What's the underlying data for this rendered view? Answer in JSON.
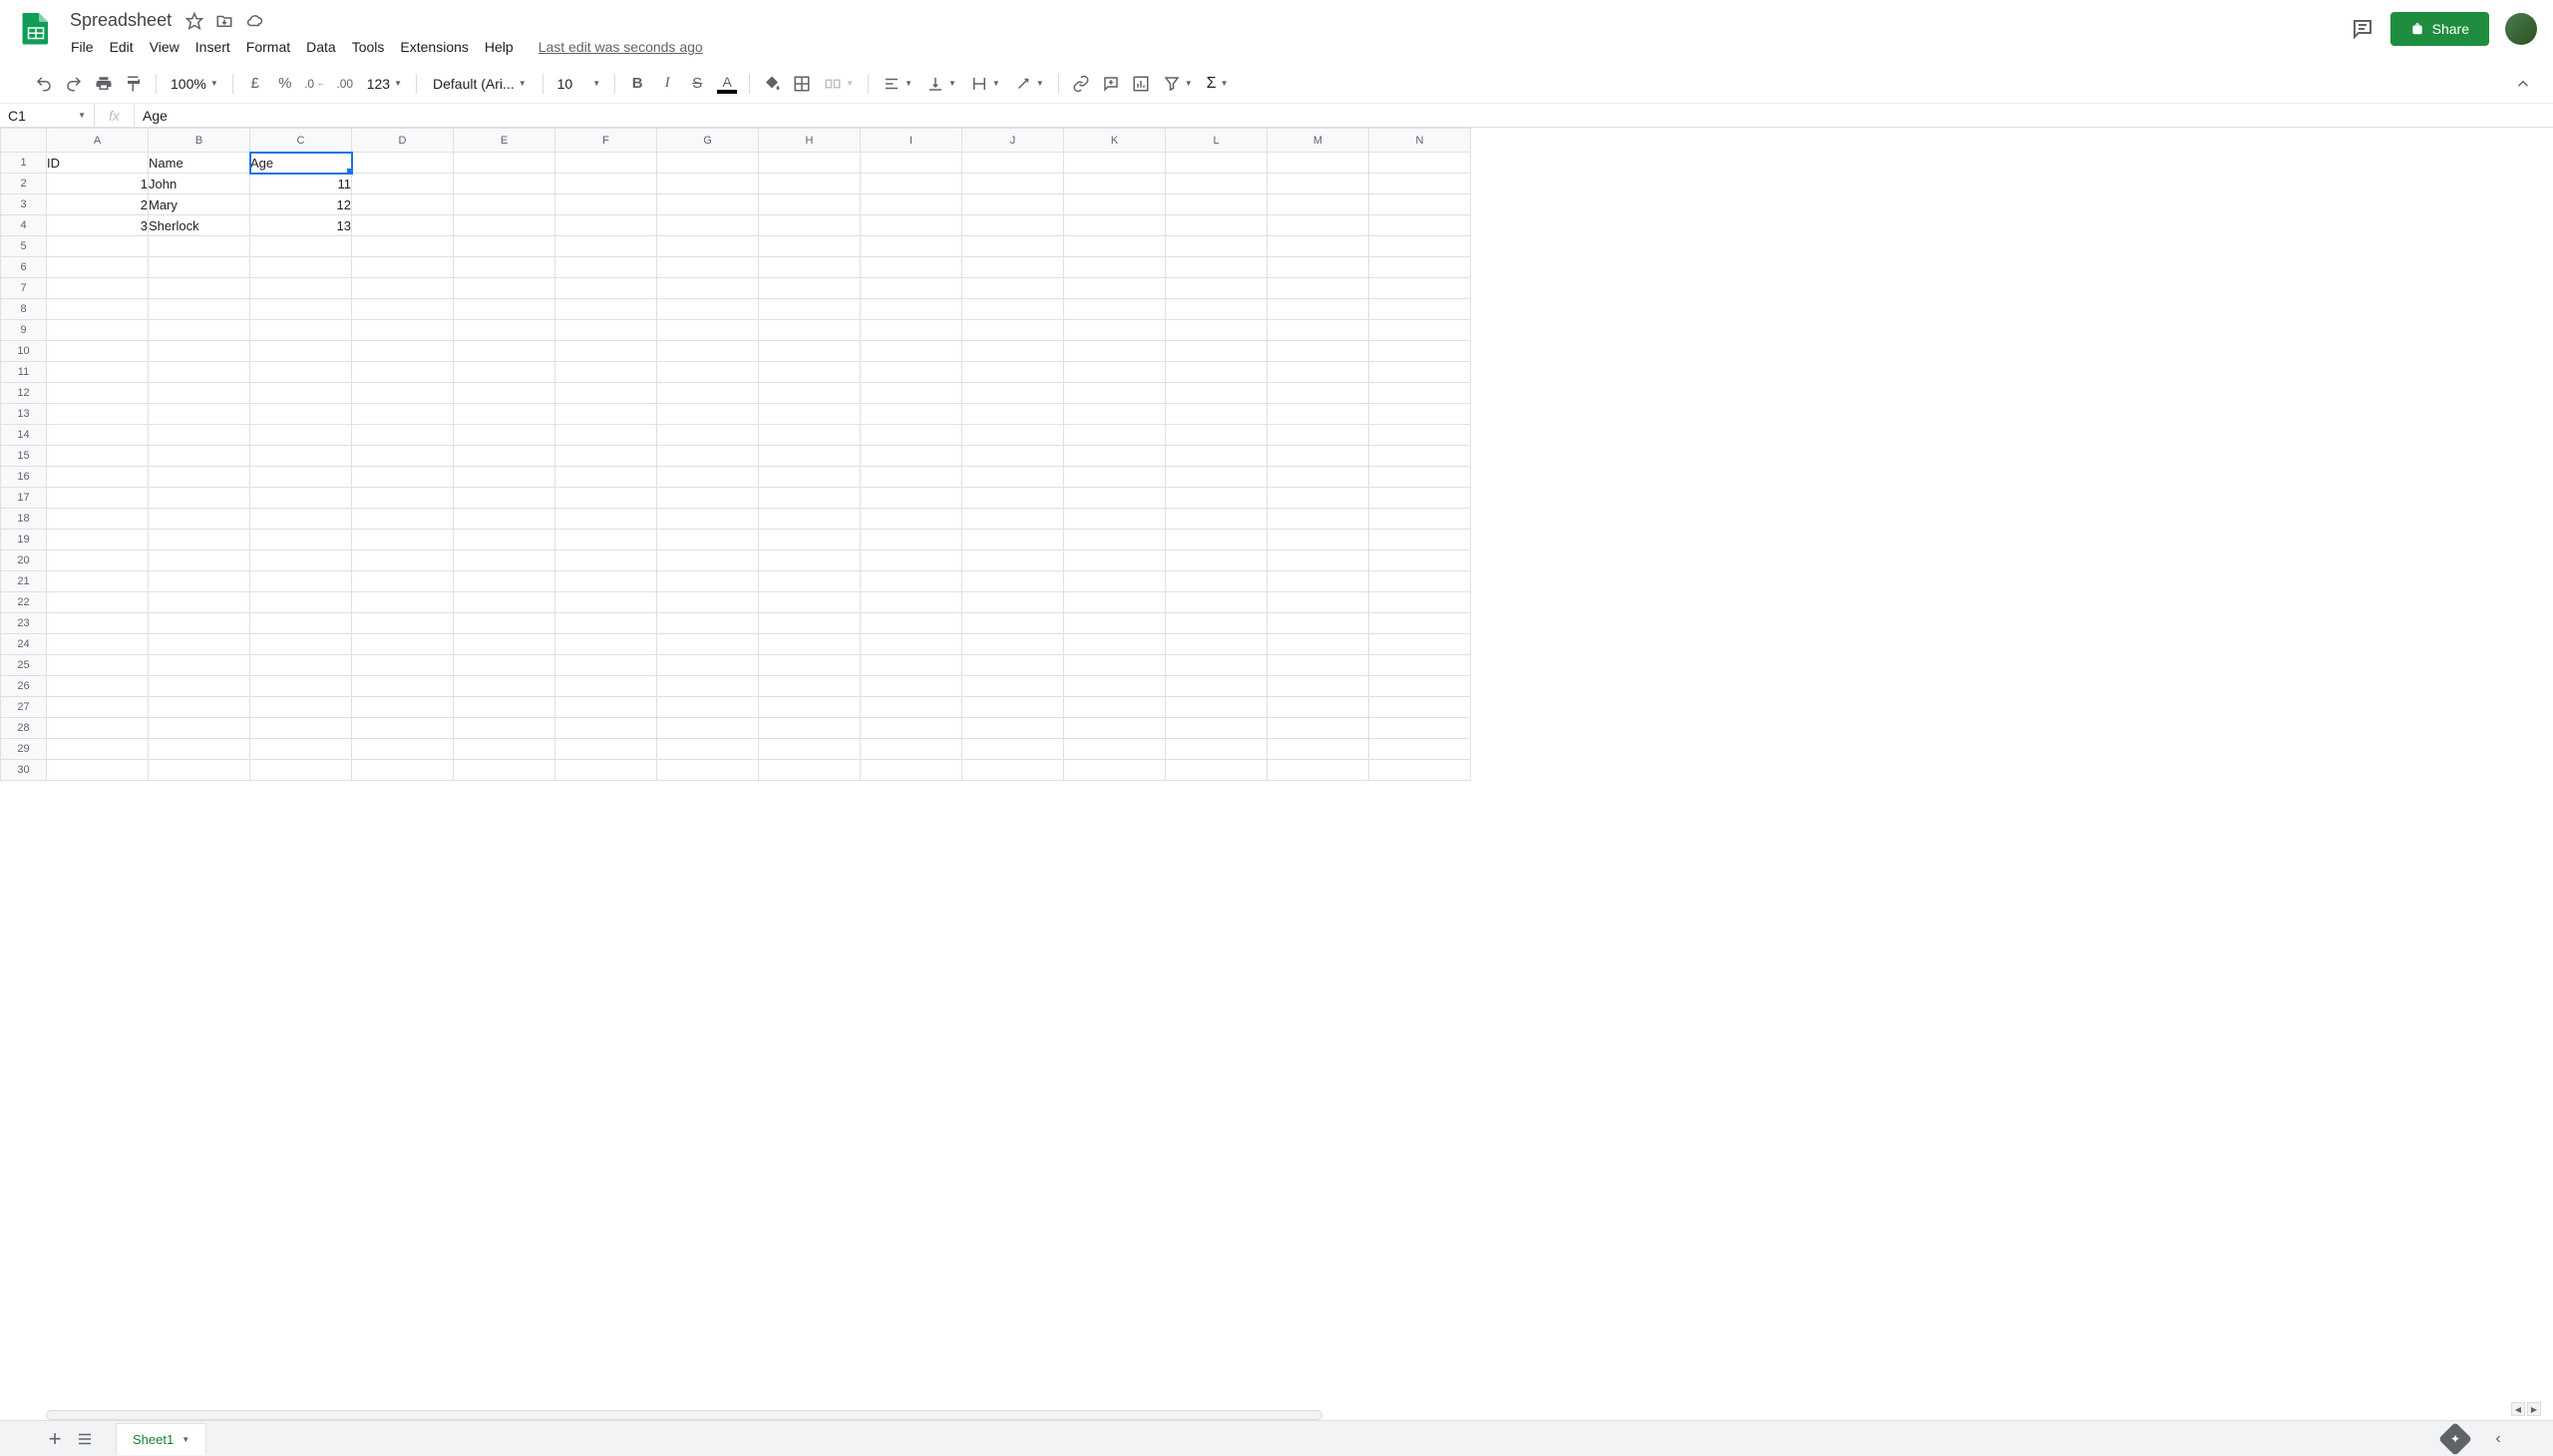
{
  "doc": {
    "title": "Spreadsheet",
    "last_edit": "Last edit was seconds ago"
  },
  "menus": [
    "File",
    "Edit",
    "View",
    "Insert",
    "Format",
    "Data",
    "Tools",
    "Extensions",
    "Help"
  ],
  "share_label": "Share",
  "toolbar": {
    "zoom": "100%",
    "currency": "£",
    "percent": "%",
    "dec_minus": ".0",
    "dec_plus": ".00",
    "num_fmt": "123",
    "font": "Default (Ari...",
    "font_size": "10"
  },
  "name_box": "C1",
  "fx_label": "fx",
  "formula_bar": "Age",
  "columns": [
    "A",
    "B",
    "C",
    "D",
    "E",
    "F",
    "G",
    "H",
    "I",
    "J",
    "K",
    "L",
    "M",
    "N"
  ],
  "row_count": 30,
  "selected_cell": {
    "row": 1,
    "col": "C"
  },
  "cells": {
    "A1": {
      "v": "ID",
      "t": "text"
    },
    "B1": {
      "v": "Name",
      "t": "text"
    },
    "C1": {
      "v": "Age",
      "t": "text"
    },
    "A2": {
      "v": "1",
      "t": "num"
    },
    "B2": {
      "v": "John",
      "t": "text"
    },
    "C2": {
      "v": "11",
      "t": "num"
    },
    "A3": {
      "v": "2",
      "t": "num"
    },
    "B3": {
      "v": "Mary",
      "t": "text"
    },
    "C3": {
      "v": "12",
      "t": "num"
    },
    "A4": {
      "v": "3",
      "t": "num"
    },
    "B4": {
      "v": "Sherlock",
      "t": "text"
    },
    "C4": {
      "v": "13",
      "t": "num"
    }
  },
  "sheet_tab": "Sheet1"
}
